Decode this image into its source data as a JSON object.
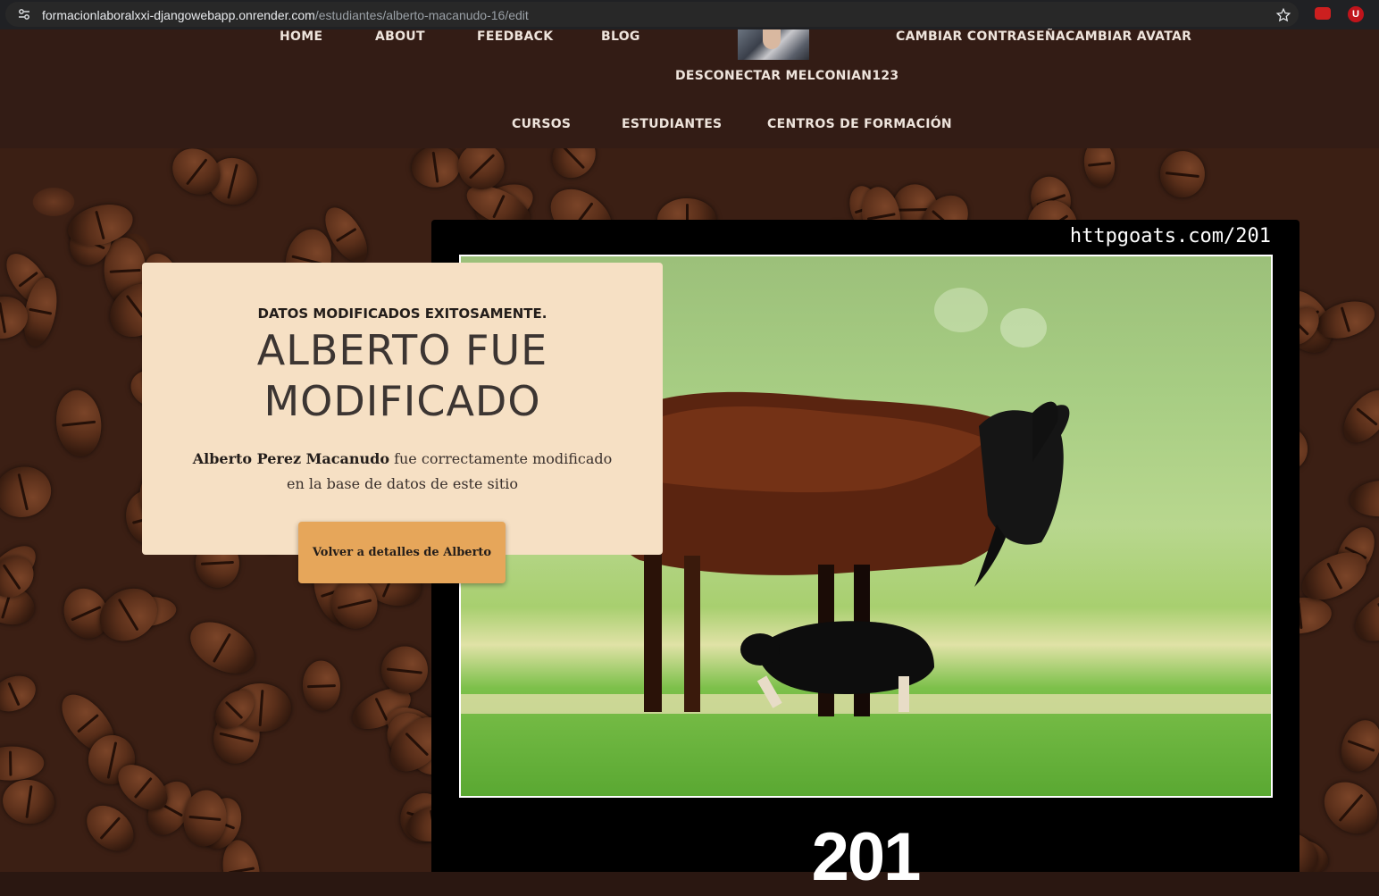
{
  "browser": {
    "url_host": "formacionlaboralxxi-djangowebapp.onrender.com",
    "url_path": "/estudiantes/alberto-macanudo-16/edit",
    "ext_u_label": "U"
  },
  "nav": {
    "home": "HOME",
    "about": "ABOUT",
    "feedback": "FEEDBACK",
    "blog": "BLOG",
    "change_password": "CAMBIAR CONTRASEÑA",
    "change_avatar": "CAMBIAR AVATAR",
    "logout": "DESCONECTAR MELCONIAN123",
    "courses": "CURSOS",
    "students": "ESTUDIANTES",
    "centers": "CENTROS DE FORMACIÓN"
  },
  "success": {
    "subtitle": "DATOS MODIFICADOS EXITOSAMENTE.",
    "title_line1": "ALBERTO FUE",
    "title_line2": "MODIFICADO",
    "student_name": "Alberto Perez Macanudo",
    "message": " fue correctamente modificado en la base de datos de este sitio",
    "back_button": "Volver a detalles de Alberto"
  },
  "goat": {
    "site": "httpgoats.com/201",
    "code": "201"
  },
  "colors": {
    "header_bg": "#331c15",
    "card_bg": "#f6e0c4",
    "button_bg": "#e6a65a"
  }
}
